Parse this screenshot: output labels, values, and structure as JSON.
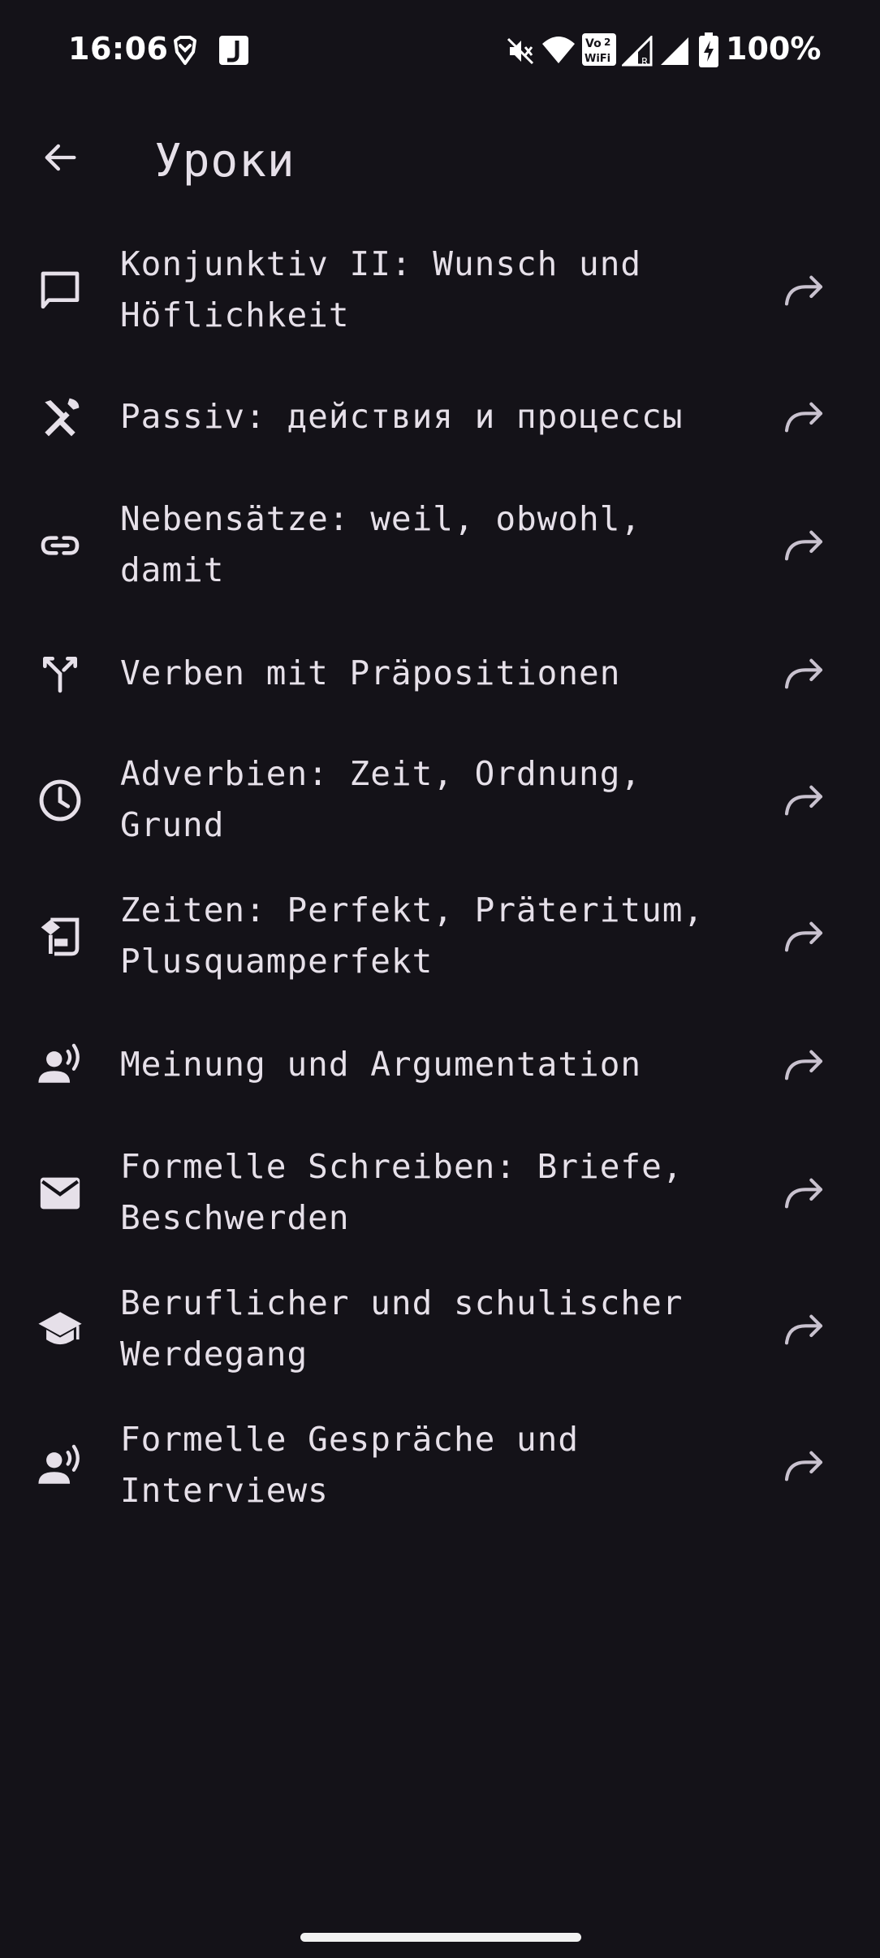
{
  "status_bar": {
    "time": "16:06",
    "battery": "100%",
    "volte_line1": "Vo",
    "volte_line2": "WiFi",
    "volte_sim": "2",
    "signal_roaming": "R",
    "icons": [
      "brave-icon",
      "jsbox-icon",
      "mute-icon",
      "wifi-icon",
      "vowifi-icon",
      "signal-icon",
      "signal-icon",
      "battery-charging-icon"
    ]
  },
  "header": {
    "title": "Уроки",
    "back_icon": "arrow-left-icon"
  },
  "lessons": [
    {
      "label": "Konjunktiv II: Wunsch und\nHöflichkeit",
      "icon": "chat-bubble-icon"
    },
    {
      "label": "Passiv: действия и процессы",
      "icon": "tools-icon"
    },
    {
      "label": "Nebensätze: weil, obwohl,\ndamit",
      "icon": "link-icon"
    },
    {
      "label": "Verben mit Präpositionen",
      "icon": "merge-icon"
    },
    {
      "label": "Adverbien: Zeit, Ordnung,\nGrund",
      "icon": "clock-icon"
    },
    {
      "label": "Zeiten: Perfekt, Präteritum,\nPlusquamperfekt",
      "icon": "history-edu-icon"
    },
    {
      "label": "Meinung und Argumentation",
      "icon": "record-voice-icon"
    },
    {
      "label": "Formelle Schreiben: Briefe,\nBeschwerden",
      "icon": "mail-icon"
    },
    {
      "label": "Beruflicher und schulischer\nWerdegang",
      "icon": "school-icon"
    },
    {
      "label": "Formelle Gespräche und\nInterviews",
      "icon": "record-voice-icon"
    }
  ],
  "share_icon": "share-arrow-icon",
  "colors": {
    "background": "#141218",
    "text": "#e6e0e9",
    "icon": "#e6e0e9"
  }
}
